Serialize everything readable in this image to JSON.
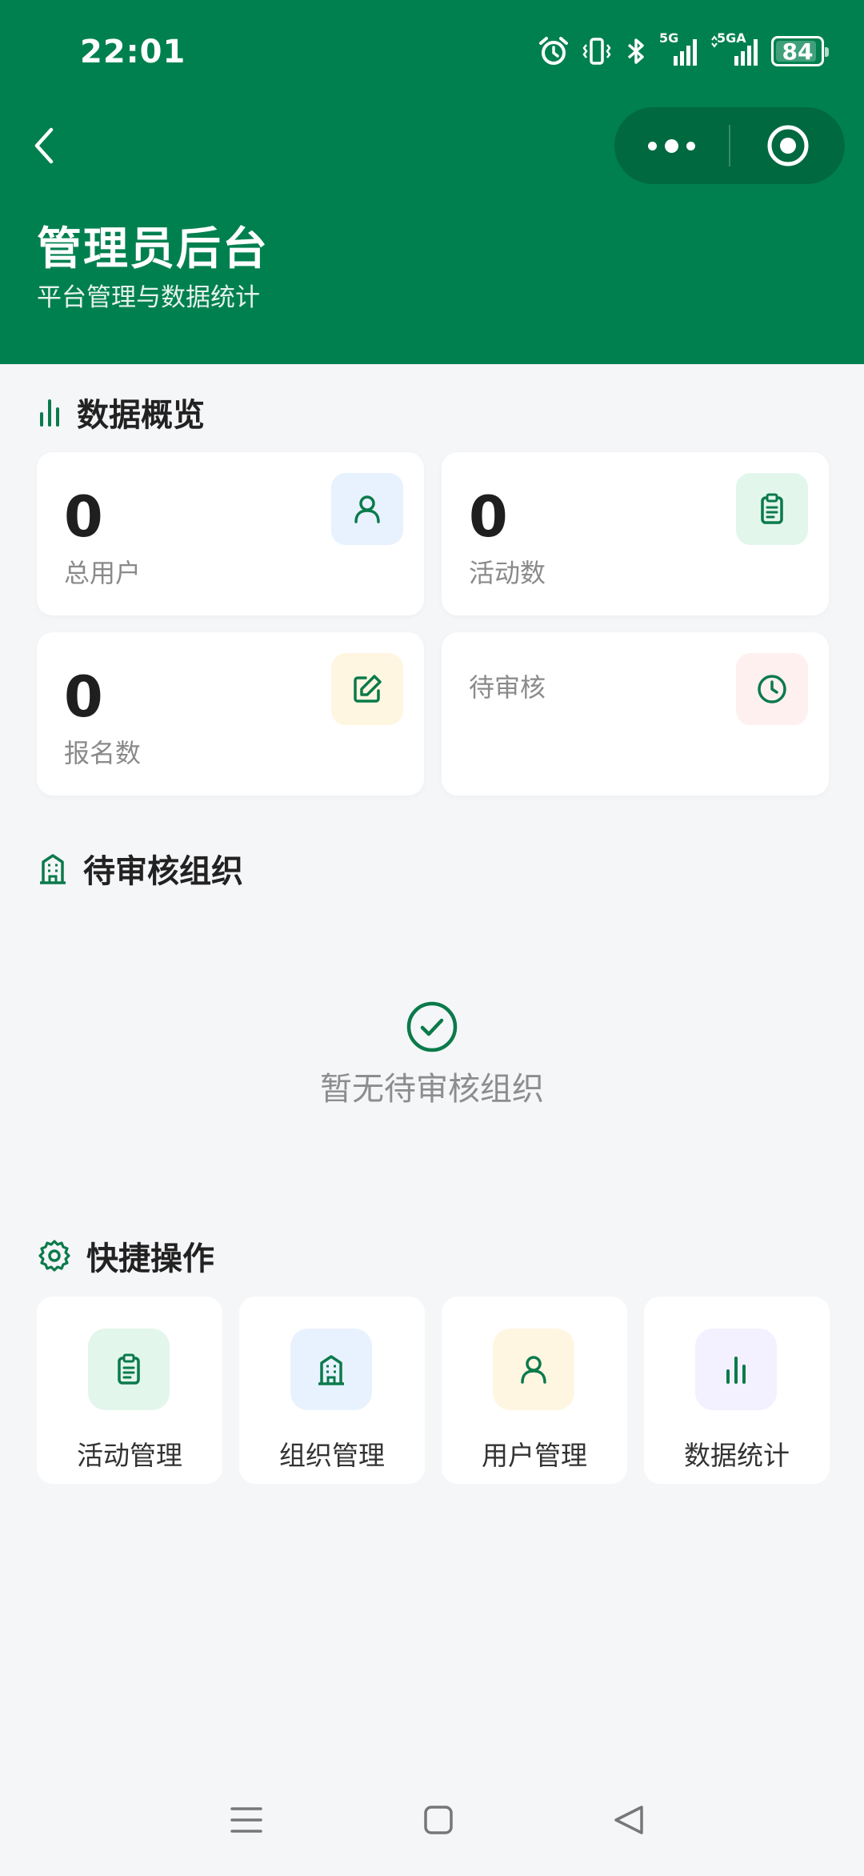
{
  "status_bar": {
    "time": "22:01",
    "battery": "84",
    "network_1": "5G",
    "network_2": "5GA"
  },
  "header": {
    "title": "管理员后台",
    "subtitle": "平台管理与数据统计"
  },
  "overview": {
    "title": "数据概览",
    "cards": [
      {
        "label": "总用户",
        "value": "0",
        "icon": "user-icon",
        "color": "#e8f2ff"
      },
      {
        "label": "活动数",
        "value": "0",
        "icon": "clipboard-icon",
        "color": "#e3f6ec"
      },
      {
        "label": "报名数",
        "value": "0",
        "icon": "edit-icon",
        "color": "#fff6e2"
      },
      {
        "label": "待审核",
        "value": "",
        "icon": "clock-icon",
        "color": "#fff0f0"
      }
    ]
  },
  "pending": {
    "title": "待审核组织",
    "empty_text": "暂无待审核组织"
  },
  "quick": {
    "title": "快捷操作",
    "items": [
      {
        "label": "活动管理",
        "icon": "clipboard-icon",
        "color": "#e3f6ec"
      },
      {
        "label": "组织管理",
        "icon": "building-icon",
        "color": "#e8f2ff"
      },
      {
        "label": "用户管理",
        "icon": "user-icon",
        "color": "#fff6e2"
      },
      {
        "label": "数据统计",
        "icon": "bar-chart-icon",
        "color": "#f3f0ff"
      }
    ]
  },
  "colors": {
    "brand": "#00804f",
    "background": "#f5f6f8",
    "icon": "#0b7a4b"
  }
}
